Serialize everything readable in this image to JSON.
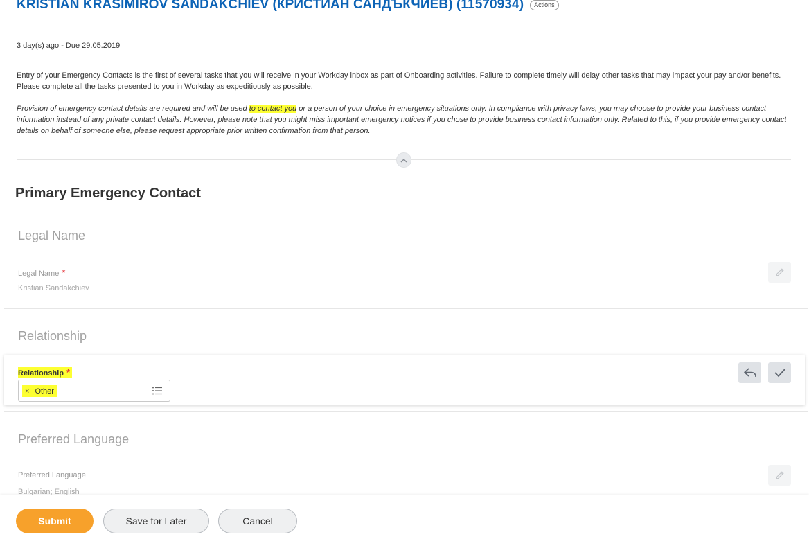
{
  "header": {
    "title": "KRISTIAN KRASIMIROV SANDAKCHIEV (КРИСТИАН САНДЪКЧИЕВ) (11570934)",
    "actions_label": "Actions"
  },
  "task": {
    "due_text": "3 day(s) ago - Due 29.05.2019"
  },
  "instructions": {
    "para1": "Entry of your Emergency Contacts is the first of several tasks that you will receive in your Workday inbox as part of Onboarding activities. Failure to complete timely will delay other tasks that may impact your pay and/or benefits. Please complete all the tasks presented to you in Workday as expeditiously as possible.",
    "p2_a": "Provision of emergency contact details are required and will be used ",
    "p2_hl": "to contact you",
    "p2_b": " or a person of your choice in emergency situations only.  In compliance with privacy laws, you may choose to provide your ",
    "p2_ul1": "business contact",
    "p2_c": " information instead of any ",
    "p2_ul2": "private contact",
    "p2_d": " details. However, please note that you might miss important emergency notices if you chose to provide business contact information only. Related to this, if you provide emergency contact details on behalf of someone else, please request appropriate prior written confirmation from that person."
  },
  "section": {
    "title": "Primary Emergency Contact"
  },
  "legal_name": {
    "group_title": "Legal Name",
    "field_label": "Legal Name",
    "required_mark": "*",
    "value": "Kristian Sandakchiev"
  },
  "relationship": {
    "group_title": "Relationship",
    "field_label": "Relationship",
    "required_mark": "*",
    "selected": "Other",
    "remove_symbol": "×"
  },
  "language": {
    "group_title": "Preferred Language",
    "field_label": "Preferred Language",
    "value": "Bulgarian; English"
  },
  "footer": {
    "submit_label": "Submit",
    "save_label": "Save for Later",
    "cancel_label": "Cancel"
  },
  "colors": {
    "title_blue": "#0c63b6",
    "highlight": "#fdff32",
    "submit_orange": "#f7a12b",
    "required_red": "#e5343a"
  },
  "icons": {
    "collapse": "chevron-up-icon",
    "edit": "pencil-icon",
    "undo": "undo-icon",
    "confirm": "checkmark-icon",
    "prompt": "list-icon",
    "remove": "close-icon"
  }
}
